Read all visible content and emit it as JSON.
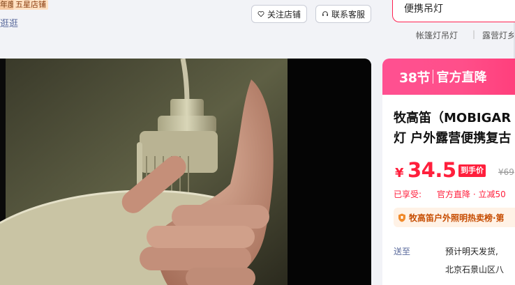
{
  "store": {
    "year_badge": "年度",
    "rating_badge": "五星店铺",
    "stroll_link": "逛逛"
  },
  "actions": {
    "follow_label": "关注店铺",
    "service_label": "联系客服"
  },
  "search": {
    "value": "便携吊灯",
    "hot_words": [
      "帐篷灯吊灯",
      "露营灯乡"
    ]
  },
  "product_image": {
    "description_icon": "lantern-photo"
  },
  "promo": {
    "festival": "38节",
    "channel": "官方直降"
  },
  "product": {
    "title_line1": "牧高笛（MOBIGAR",
    "title_line2": "灯 户外露营便携复古",
    "currency": "¥",
    "price": "34.5",
    "price_tag": "到手价",
    "original_price": "¥69",
    "enjoyed_label": "已享受:",
    "enjoyed_detail": "官方直降 · 立减50",
    "rank_text": "牧高笛户外照明热卖榜·第",
    "ship_label": "送至",
    "ship_text": "预计明天发货, ",
    "ship_address": "北京石景山区八"
  },
  "colors": {
    "accent": "#ff1f3c",
    "promo_pink": "#ff5091",
    "rank_bg": "#fff2e6"
  }
}
